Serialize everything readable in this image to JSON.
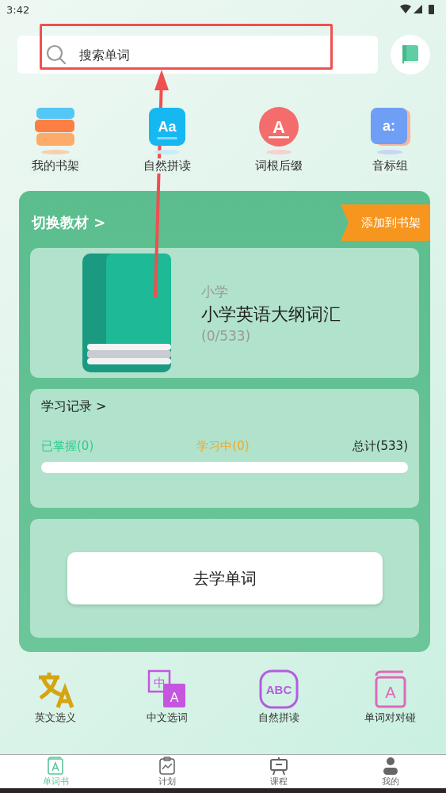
{
  "status_bar": {
    "time": "3:42"
  },
  "search": {
    "placeholder": "搜索单词"
  },
  "shortcuts": [
    {
      "label": "我的书架",
      "kind": "shelf"
    },
    {
      "label": "自然拼读",
      "kind": "phonics",
      "glyph": "Aa"
    },
    {
      "label": "词根后缀",
      "kind": "root",
      "glyph": "A"
    },
    {
      "label": "音标组",
      "kind": "phonetic",
      "glyph": "a:"
    }
  ],
  "book_card": {
    "switch_label": "切换教材 >",
    "ribbon": "添加到书架",
    "level_label": "小学",
    "book_title": "小学英语大纲词汇",
    "progress_text": "(0/533)"
  },
  "study_record": {
    "title": "学习记录 >",
    "stats": [
      {
        "label": "已掌握(0)",
        "color": "#2ecc8f"
      },
      {
        "label": "学习中(0)",
        "color": "#f5a623"
      },
      {
        "label": "总计(533)",
        "color": "#222222"
      }
    ],
    "level": 0
  },
  "start_button": "去学单词",
  "features": [
    {
      "label": "英文选义",
      "kind": "translate"
    },
    {
      "label": "中文选词",
      "kind": "zh",
      "glyph": "中",
      "glyph2": "A"
    },
    {
      "label": "自然拼读",
      "kind": "abc",
      "glyph": "ABC"
    },
    {
      "label": "单词对对碰",
      "kind": "book",
      "glyph": "A"
    }
  ],
  "tabs": [
    {
      "label": "单词书",
      "kind": "book",
      "selected": true
    },
    {
      "label": "计划",
      "kind": "plan",
      "selected": false
    },
    {
      "label": "课程",
      "kind": "course",
      "selected": false
    },
    {
      "label": "我的",
      "kind": "user",
      "selected": false
    }
  ]
}
